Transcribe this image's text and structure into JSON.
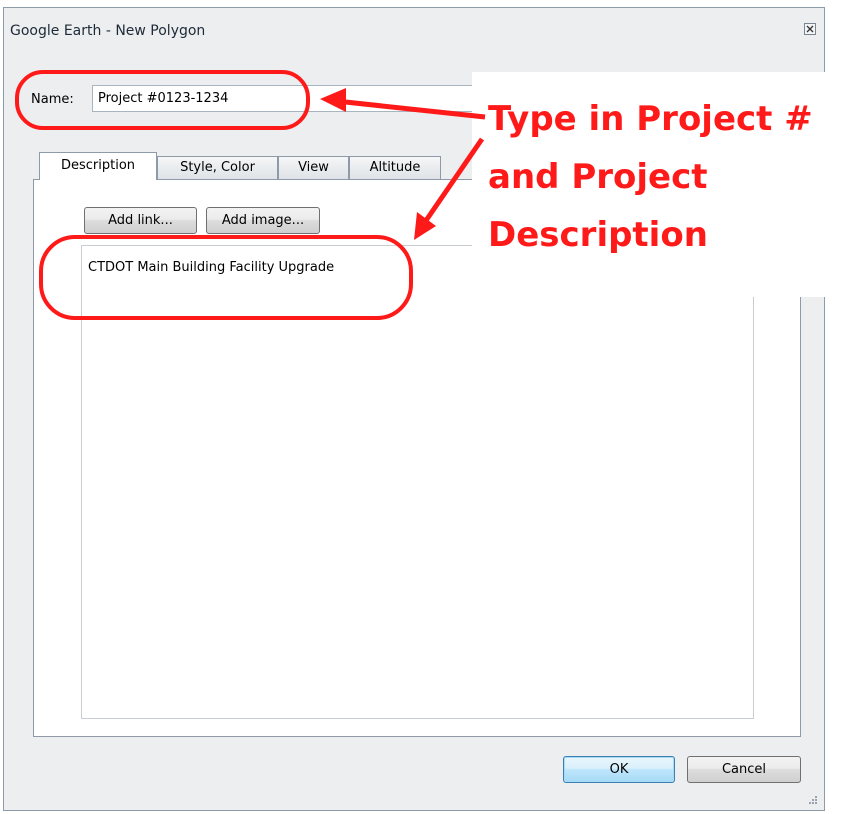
{
  "window": {
    "title": "Google Earth - New Polygon"
  },
  "name_field": {
    "label": "Name:",
    "value": "Project #0123-1234"
  },
  "tabs": [
    {
      "label": "Description",
      "active": true
    },
    {
      "label": "Style, Color",
      "active": false
    },
    {
      "label": "View",
      "active": false
    },
    {
      "label": "Altitude",
      "active": false
    }
  ],
  "description": {
    "add_link_label": "Add link...",
    "add_image_label": "Add image...",
    "text": "CTDOT Main Building Facility Upgrade"
  },
  "footer": {
    "ok_label": "OK",
    "cancel_label": "Cancel"
  },
  "annotation": {
    "lines": [
      "Type in Project #",
      "and Project",
      "Description"
    ],
    "color": "#ff1a1a"
  },
  "icons": {
    "close": "close-icon",
    "resize": "resize-grip-icon"
  }
}
